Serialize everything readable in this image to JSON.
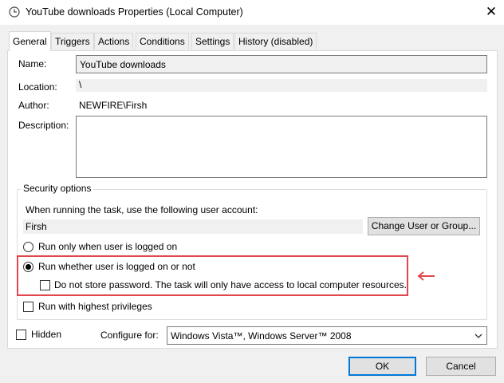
{
  "window": {
    "title": "YouTube downloads Properties (Local Computer)",
    "close_glyph": "✕"
  },
  "tabs": [
    {
      "label": "General",
      "active": true
    },
    {
      "label": "Triggers"
    },
    {
      "label": "Actions"
    },
    {
      "label": "Conditions"
    },
    {
      "label": "Settings"
    },
    {
      "label": "History (disabled)"
    }
  ],
  "general": {
    "name_label": "Name:",
    "name_value": "YouTube downloads",
    "location_label": "Location:",
    "location_value": "\\",
    "author_label": "Author:",
    "author_value": "NEWFIRE\\Firsh",
    "description_label": "Description:",
    "description_value": ""
  },
  "security": {
    "legend": "Security options",
    "account_prompt": "When running the task, use the following user account:",
    "account_value": "Firsh",
    "change_user_button": "Change User or Group...",
    "radio_logged_on": "Run only when user is logged on",
    "radio_whether": "Run whether user is logged on or not",
    "do_not_store": "Do not store password.  The task will only have access to local computer resources.",
    "highest_privileges": "Run with highest privileges",
    "selected_option": "Run whether user is logged on or not",
    "do_not_store_checked": false,
    "highest_privileges_checked": false
  },
  "bottom": {
    "hidden_label": "Hidden",
    "hidden_checked": false,
    "configure_label": "Configure for:",
    "configure_value": "Windows Vista™, Windows Server™ 2008"
  },
  "buttons": {
    "ok": "OK",
    "cancel": "Cancel"
  },
  "annotation": {
    "color": "#e0474e",
    "arrow_glyph": "←"
  },
  "colors": {
    "window_bg": "#f0f0f0",
    "panel_bg": "#ffffff",
    "focus_blue": "#0078d7"
  }
}
